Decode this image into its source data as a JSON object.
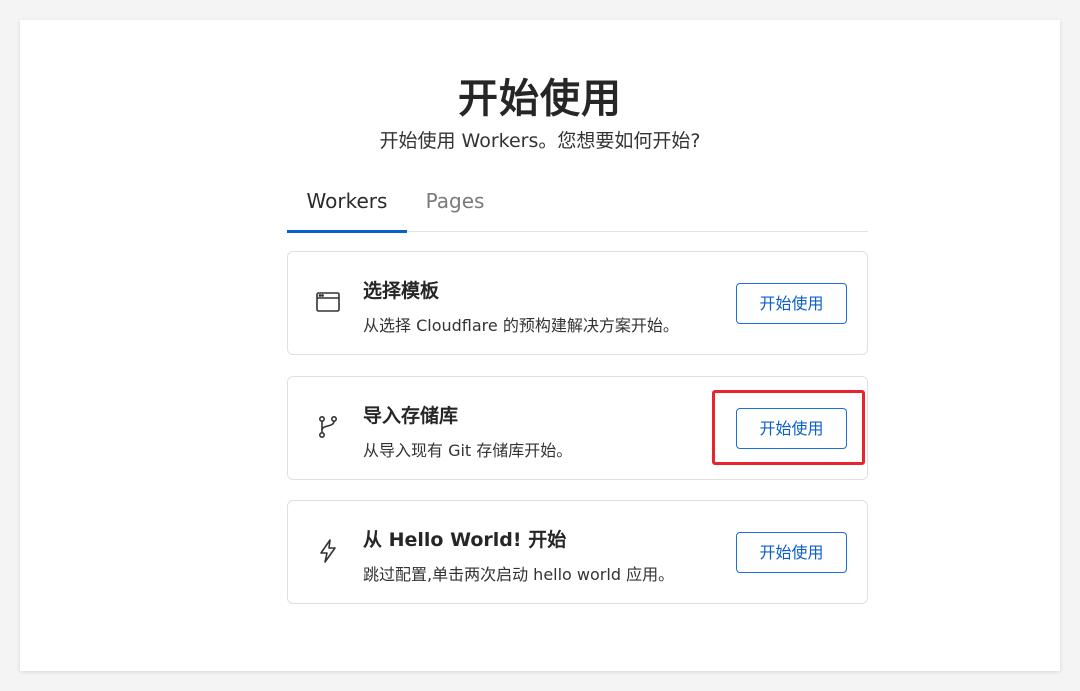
{
  "header": {
    "title": "开始使用",
    "subtitle": "开始使用 Workers。您想要如何开始?"
  },
  "tabs": [
    {
      "label": "Workers",
      "active": true
    },
    {
      "label": "Pages",
      "active": false
    }
  ],
  "cards": [
    {
      "icon": "browser-window-icon",
      "title": "选择模板",
      "description": "从选择 Cloudflare 的预构建解决方案开始。",
      "button": "开始使用"
    },
    {
      "icon": "git-branch-icon",
      "title": "导入存储库",
      "description": "从导入现有 Git 存储库开始。",
      "button": "开始使用",
      "highlighted": true
    },
    {
      "icon": "lightning-bolt-icon",
      "title": "从 Hello World! 开始",
      "description": "跳过配置,单击两次启动 hello world 应用。",
      "button": "开始使用"
    }
  ],
  "colors": {
    "accent": "#0b5fcd",
    "highlight": "#e8242e",
    "text": "#262626"
  }
}
